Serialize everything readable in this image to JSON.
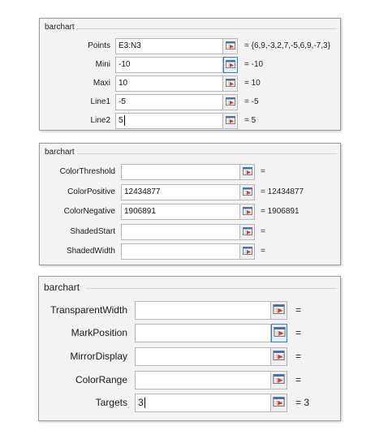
{
  "panels": [
    {
      "title": "barchart",
      "rows": [
        {
          "label": "Points",
          "value": "E3:N3",
          "result": "= {6,9,-3,2,7,-5,6,9,-7,3}"
        },
        {
          "label": "Mini",
          "value": "-10",
          "result": "= -10"
        },
        {
          "label": "Maxi",
          "value": "10",
          "result": "= 10"
        },
        {
          "label": "Line1",
          "value": "-5",
          "result": "= -5"
        },
        {
          "label": "Line2",
          "value": "5",
          "result": "= 5"
        }
      ]
    },
    {
      "title": "barchart",
      "rows": [
        {
          "label": "ColorThreshold",
          "value": "",
          "result": "="
        },
        {
          "label": "ColorPositive",
          "value": "12434877",
          "result": "= 12434877"
        },
        {
          "label": "ColorNegative",
          "value": "1906891",
          "result": "= 1906891"
        },
        {
          "label": "ShadedStart",
          "value": "",
          "result": "="
        },
        {
          "label": "ShadedWidth",
          "value": "",
          "result": "="
        }
      ]
    },
    {
      "title": "barchart",
      "rows": [
        {
          "label": "TransparentWidth",
          "value": "",
          "result": "="
        },
        {
          "label": "MarkPosition",
          "value": "",
          "result": "="
        },
        {
          "label": "MirrorDisplay",
          "value": "",
          "result": "="
        },
        {
          "label": "ColorRange",
          "value": "",
          "result": "="
        },
        {
          "label": "Targets",
          "value": "3",
          "result": "=  3"
        }
      ]
    }
  ],
  "icons": {
    "range_button": "range-select-icon"
  },
  "colors": {
    "accent_border": "#3a7bd5",
    "icon_red": "#d63a2f",
    "icon_blue": "#3a6fc4"
  }
}
